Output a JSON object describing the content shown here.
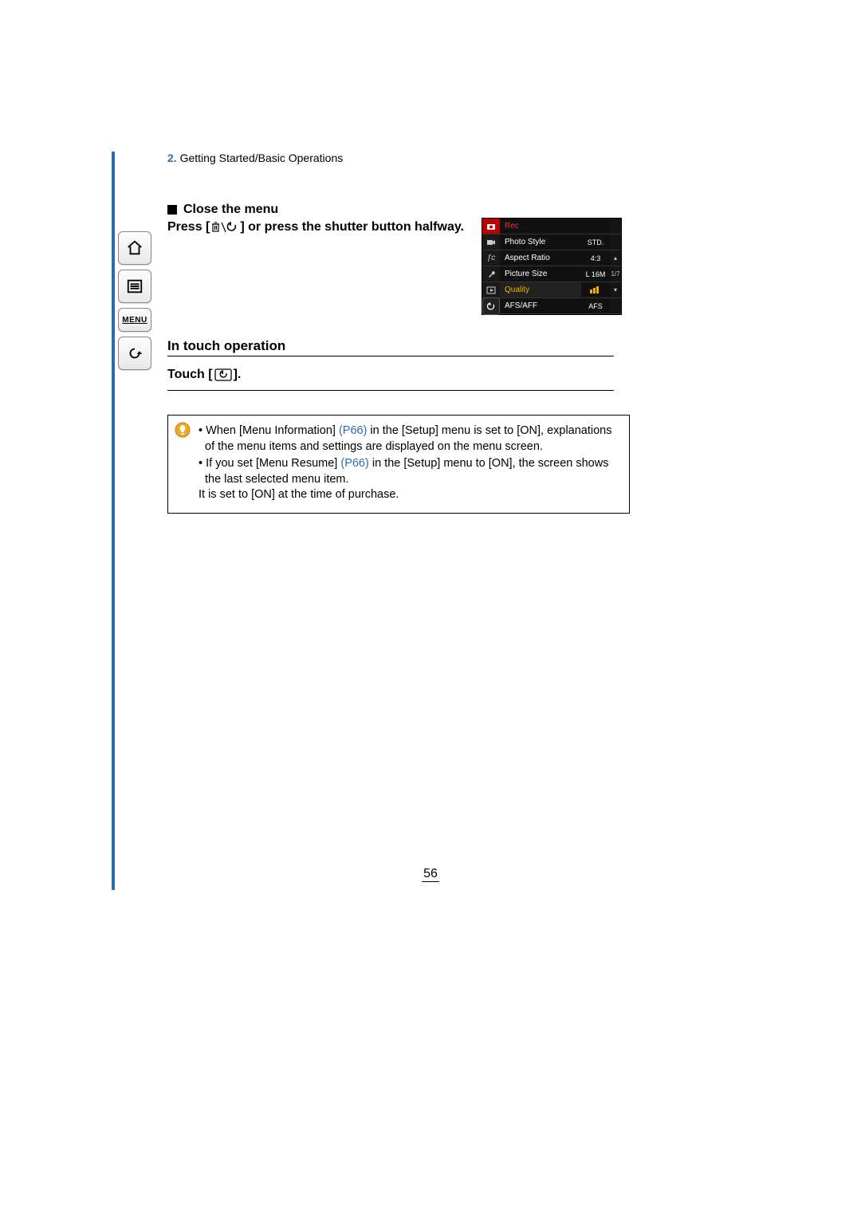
{
  "breadcrumb": {
    "number": "2.",
    "text": "Getting Started/Basic Operations"
  },
  "sidebar": {
    "menu_label": "MENU"
  },
  "section": {
    "close_title": "Close the menu",
    "press_before": "Press [",
    "press_after": "] or press the shutter button halfway.",
    "touch_op_heading": "In touch operation",
    "touch_before": "Touch [",
    "touch_after": "]."
  },
  "note": {
    "b1_a": "When [Menu Information] ",
    "b1_link": "(P66)",
    "b1_b": " in the [Setup] menu is set to [ON], explanations of the menu items and settings are displayed on the menu screen.",
    "b2_a": "If you set [Menu Resume] ",
    "b2_link": "(P66)",
    "b2_b": " in the [Setup] menu to [ON], the screen shows the last selected menu item.",
    "b2_c": "It is set to [ON] at the time of purchase."
  },
  "lcd": {
    "header": "Rec",
    "rows": [
      {
        "label": "Photo Style",
        "value": "STD."
      },
      {
        "label": "Aspect Ratio",
        "value": "4:3"
      },
      {
        "label": "Picture Size",
        "value": "L 16M"
      },
      {
        "label": "Quality",
        "value": "",
        "highlight": true
      },
      {
        "label": "AFS/AFF",
        "value": "AFS"
      }
    ],
    "page_indicator": "1/7"
  },
  "page_number": "56"
}
